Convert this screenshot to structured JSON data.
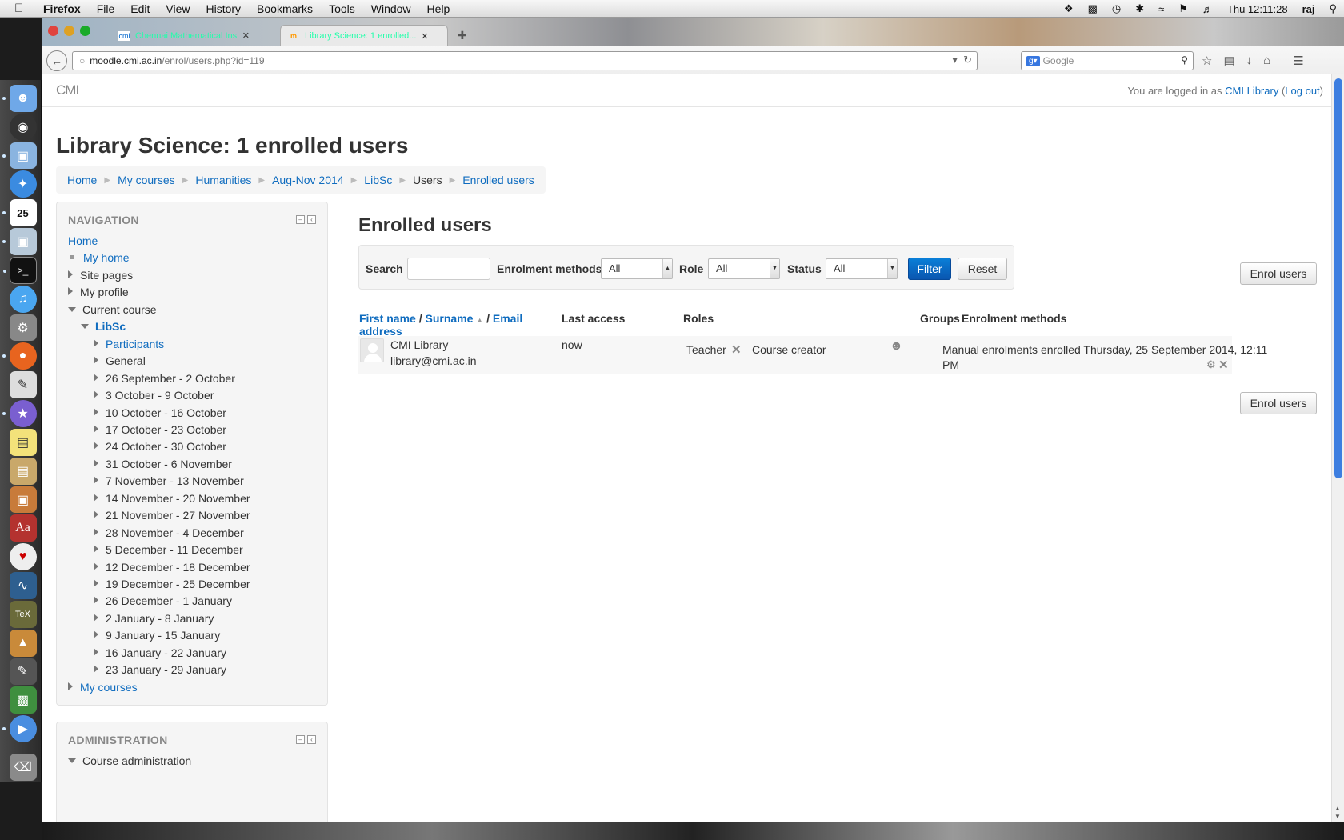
{
  "menubar": {
    "app_name": "Firefox",
    "menus": [
      "File",
      "Edit",
      "View",
      "History",
      "Bookmarks",
      "Tools",
      "Window",
      "Help"
    ],
    "clock": "Thu 12:11:28",
    "user": "raj"
  },
  "browser": {
    "tabs": [
      {
        "label": "Chennai Mathematical Ins..."
      },
      {
        "label": "Library Science: 1 enrolled..."
      }
    ],
    "url_host": "moodle.cmi.ac.in",
    "url_path": "/enrol/users.php?id=119",
    "search_placeholder": "Google"
  },
  "header": {
    "brand": "CMI",
    "login_prefix": "You are logged in as",
    "login_user": "CMI Library",
    "logout_label": "Log out"
  },
  "page": {
    "title": "Library Science: 1 enrolled users",
    "breadcrumb": [
      "Home",
      "My courses",
      "Humanities",
      "Aug-Nov 2014",
      "LibSc",
      "Users",
      "Enrolled users"
    ]
  },
  "navigation": {
    "title": "NAVIGATION",
    "home": "Home",
    "my_home": "My home",
    "site_pages": "Site pages",
    "my_profile": "My profile",
    "current_course": "Current course",
    "course": "LibSc",
    "participants": "Participants",
    "general": "General",
    "weeks": [
      "26 September - 2 October",
      "3 October - 9 October",
      "10 October - 16 October",
      "17 October - 23 October",
      "24 October - 30 October",
      "31 October - 6 November",
      "7 November - 13 November",
      "14 November - 20 November",
      "21 November - 27 November",
      "28 November - 4 December",
      "5 December - 11 December",
      "12 December - 18 December",
      "19 December - 25 December",
      "26 December - 1 January",
      "2 January - 8 January",
      "9 January - 15 January",
      "16 January - 22 January",
      "23 January - 29 January"
    ],
    "my_courses": "My courses"
  },
  "administration": {
    "title": "ADMINISTRATION",
    "course_admin": "Course administration"
  },
  "main": {
    "heading": "Enrolled users",
    "filters": {
      "search_label": "Search",
      "search_value": "",
      "methods_label": "Enrolment methods",
      "methods_value": "All",
      "role_label": "Role",
      "role_value": "All",
      "status_label": "Status",
      "status_value": "All",
      "filter_button": "Filter",
      "reset_button": "Reset"
    },
    "enrol_button": "Enrol users",
    "columns": {
      "first_name": "First name",
      "slash1": "/",
      "surname": "Surname",
      "slash2": "/",
      "email_line1": "Email",
      "email_line2": "address",
      "last_access": "Last access",
      "roles": "Roles",
      "groups": "Groups",
      "methods": "Enrolment methods"
    },
    "users": [
      {
        "name": "CMI Library",
        "email": "library@cmi.ac.in",
        "last_access": "now",
        "role1": "Teacher",
        "role2": "Course creator",
        "method_line1": "Manual enrolments enrolled Thursday, 25 September 2014, 12:11",
        "method_line2": "PM"
      }
    ]
  },
  "colors": {
    "link": "#0f6cbf",
    "primary_button": "#0a6cc8",
    "scroll_thumb": "#3d7ee0"
  }
}
